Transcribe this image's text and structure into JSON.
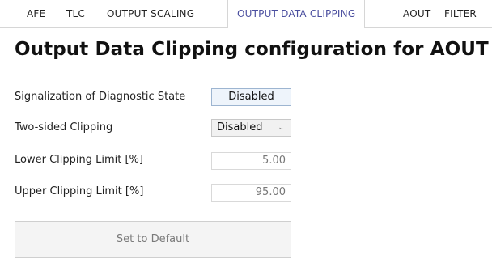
{
  "tabs": [
    {
      "label": "AFE"
    },
    {
      "label": "TLC"
    },
    {
      "label": "OUTPUT SCALING"
    },
    {
      "label": "OUTPUT DATA CLIPPING",
      "active": true
    },
    {
      "label": "AOUT"
    },
    {
      "label": "FILTER"
    }
  ],
  "title": "Output Data Clipping configuration for AOUT",
  "fields": {
    "signalization": {
      "label": "Signalization of Diagnostic State",
      "value": "Disabled"
    },
    "two_sided": {
      "label": "Two-sided Clipping",
      "value": "Disabled",
      "icon": "chevron-down-icon"
    },
    "lower": {
      "label": "Lower Clipping Limit [%]",
      "value": "5.00"
    },
    "upper": {
      "label": "Upper Clipping Limit [%]",
      "value": "95.00"
    }
  },
  "buttons": {
    "set_default": "Set to Default"
  },
  "colors": {
    "active_tab": "#4b4f9f",
    "toggle_border": "#9db5d1",
    "toggle_bg": "#eef4fb"
  }
}
